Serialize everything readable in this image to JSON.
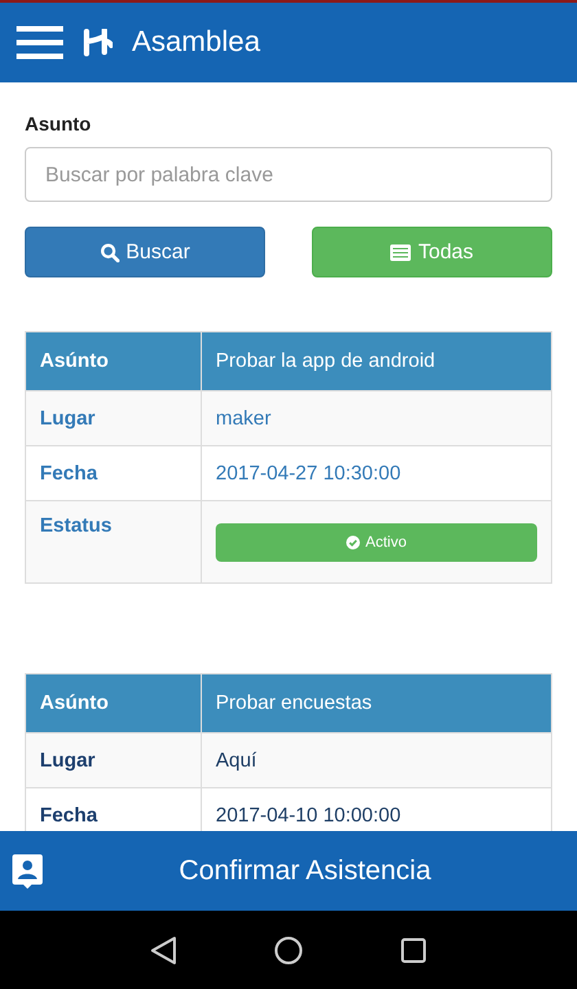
{
  "app_bar": {
    "title": "Asamblea"
  },
  "search": {
    "label": "Asunto",
    "placeholder": "Buscar por palabra clave"
  },
  "buttons": [
    {
      "label": "Buscar",
      "kind": "search"
    },
    {
      "label": "Todas",
      "kind": "all"
    }
  ],
  "meetings": [
    {
      "selected": true,
      "subject_label": "Asúnto",
      "subject": "Probar la app de android",
      "rows": [
        {
          "label": "Lugar",
          "value": "maker",
          "kind": "text"
        },
        {
          "label": "Fecha",
          "value": "2017-04-27 10:30:00",
          "kind": "text"
        },
        {
          "label": "Estatus",
          "value": "Activo",
          "kind": "status"
        }
      ]
    },
    {
      "selected": false,
      "subject_label": "Asúnto",
      "subject": "Probar encuestas",
      "rows": [
        {
          "label": "Lugar",
          "value": "Aquí",
          "kind": "text"
        },
        {
          "label": "Fecha",
          "value": "2017-04-10 10:00:00",
          "kind": "text"
        }
      ]
    }
  ],
  "bottom_bar": {
    "label": "Confirmar Asistencia"
  }
}
